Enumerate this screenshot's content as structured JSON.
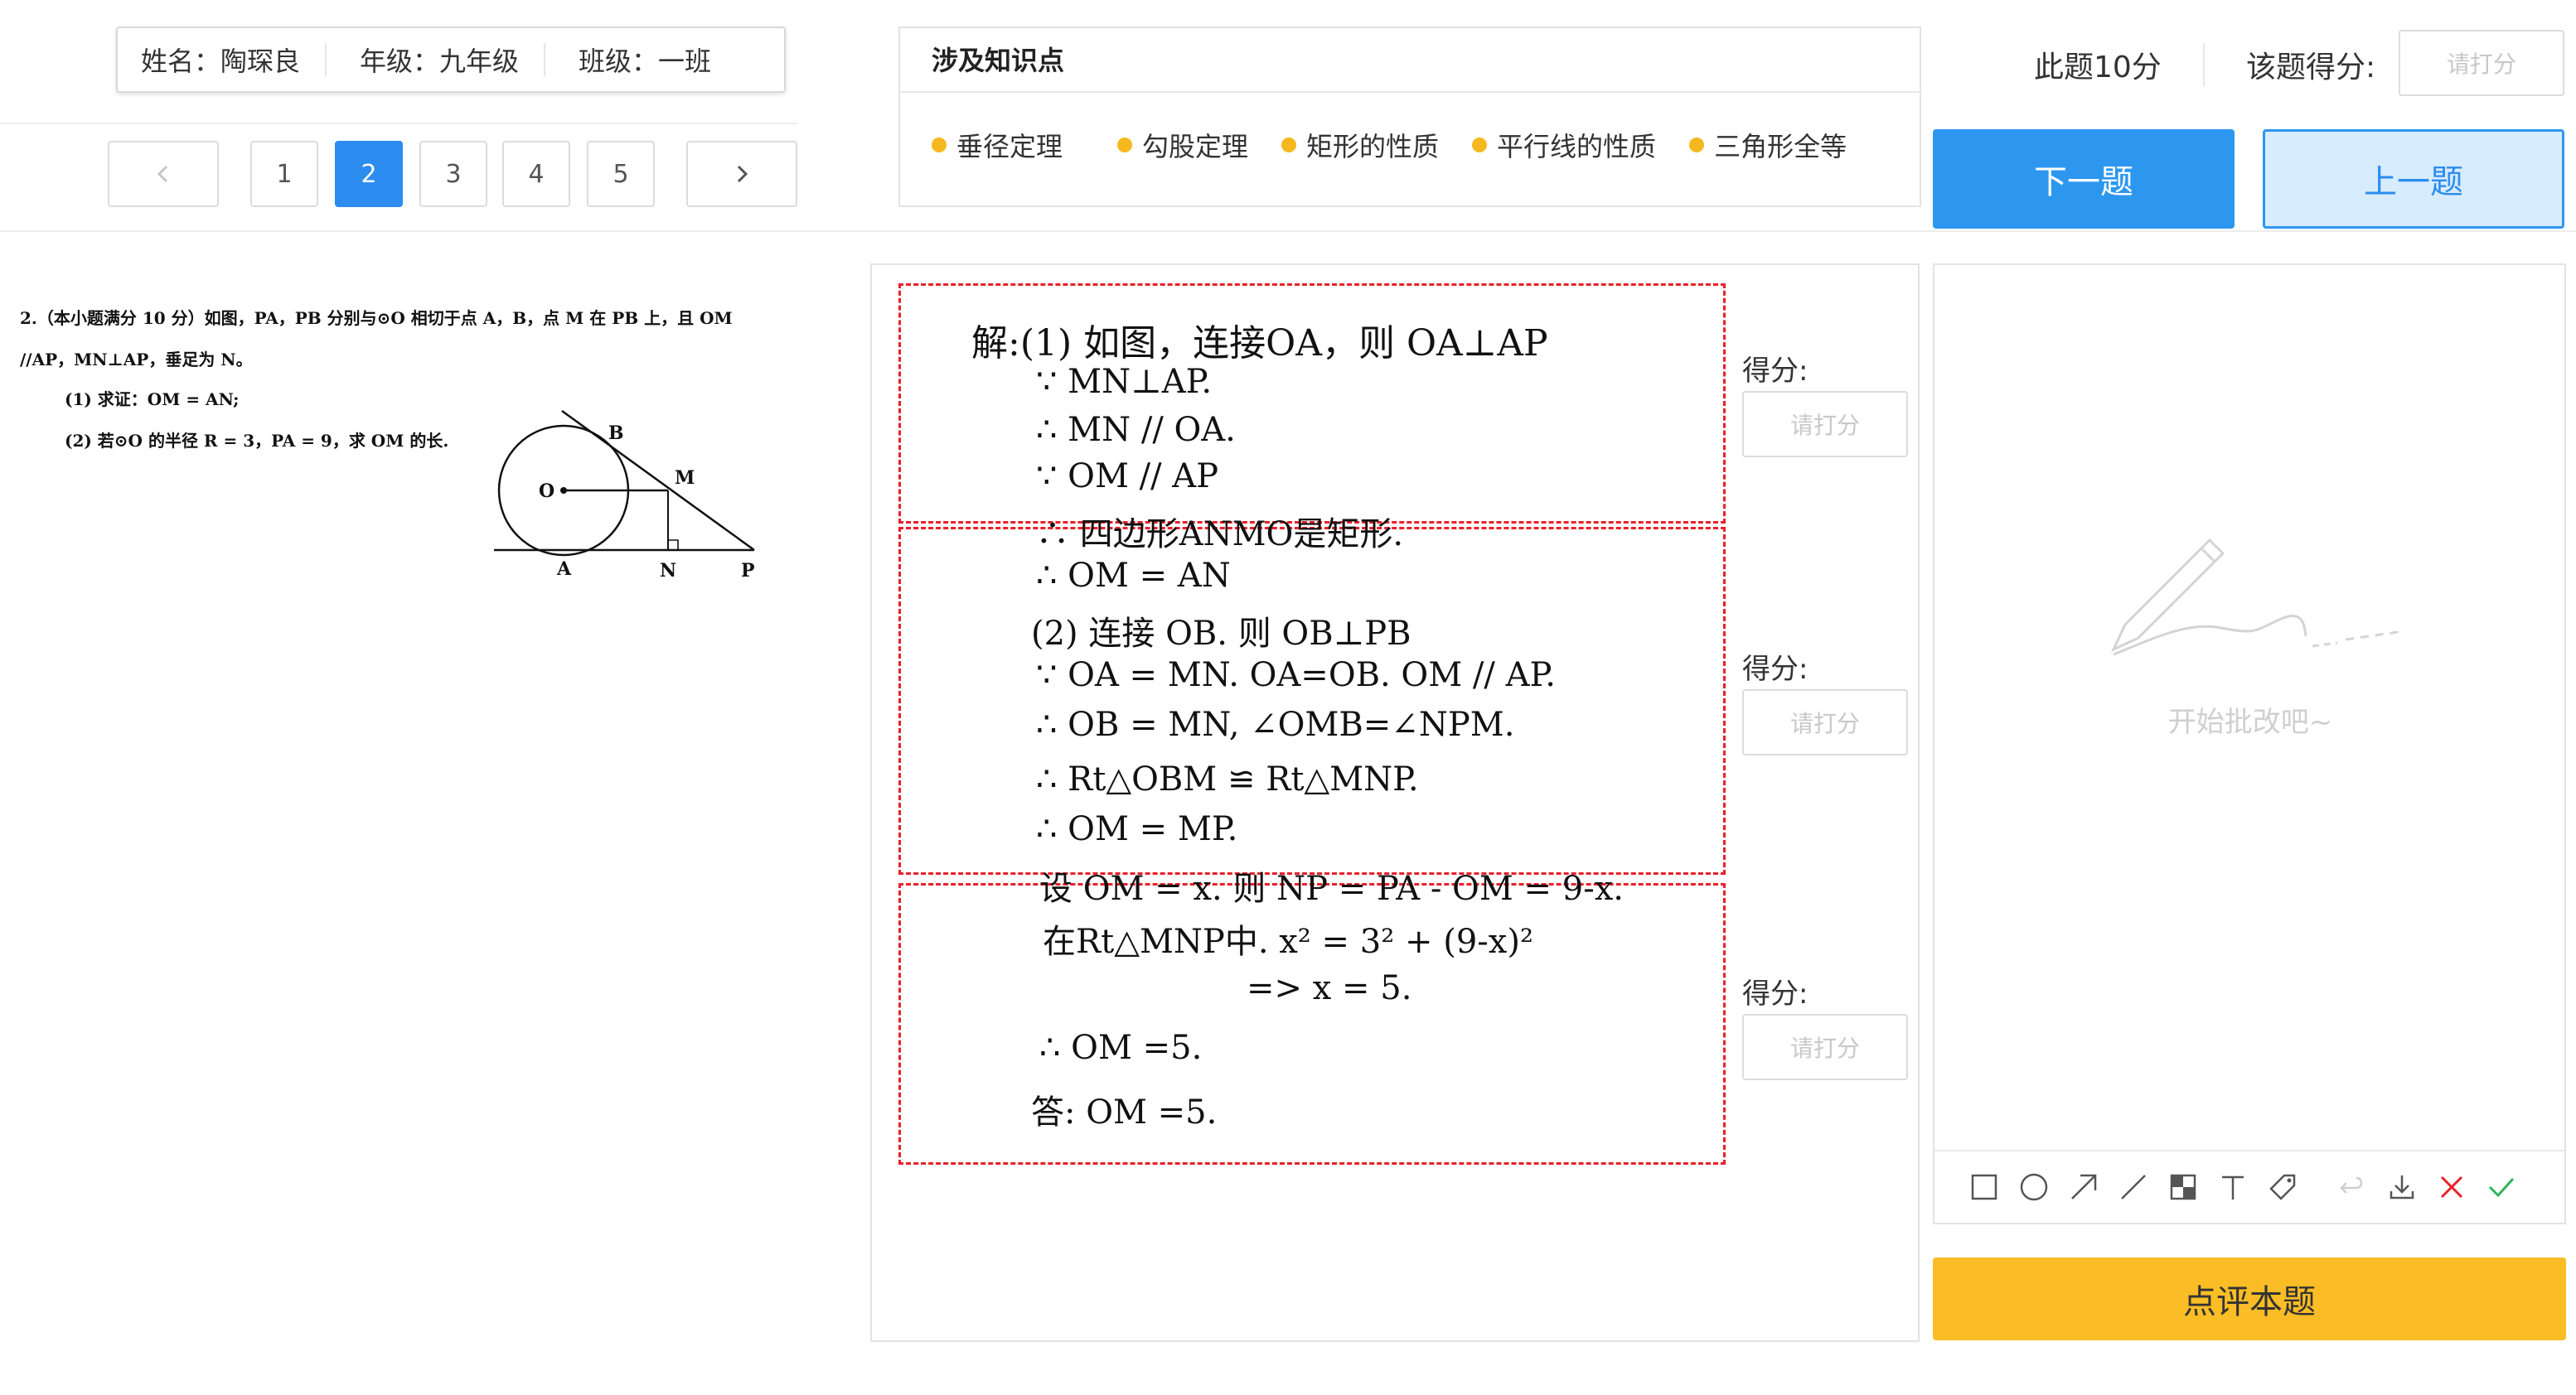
{
  "student": {
    "name_label": "姓名：陶琛良",
    "grade_label": "年级：九年级",
    "class_label": "班级：一班"
  },
  "pager": {
    "pages": [
      "1",
      "2",
      "3",
      "4",
      "5"
    ],
    "current": "2"
  },
  "knowledge": {
    "title": "涉及知识点",
    "items": [
      "垂径定理",
      "勾股定理",
      "矩形的性质",
      "平行线的性质",
      "三角形全等"
    ]
  },
  "score_header": {
    "total": "此题10分",
    "label": "该题得分:",
    "placeholder": "请打分"
  },
  "buttons": {
    "next": "下一题",
    "prev": "上一题",
    "review": "点评本题"
  },
  "question": {
    "line1": "2.（本小题满分 10 分）如图，PA，PB 分别与⊙O 相切于点 A，B，点 M 在 PB 上，且 OM",
    "line2": "//AP，MN⊥AP，垂足为 N。",
    "line3": "(1) 求证：OM = AN;",
    "line4": "(2) 若⊙O 的半径 R = 3，PA = 9，求 OM 的长.",
    "figure_labels": {
      "O": "O",
      "B": "B",
      "M": "M",
      "A": "A",
      "N": "N",
      "P": "P"
    }
  },
  "answer": {
    "lines": [
      "解:(1) 如图，连接OA，则 OA⊥AP",
      "∵ MN⊥AP.",
      "∴ MN // OA.",
      "∵ OM // AP",
      "∴ 四边形ANMO是矩形.",
      "∴ OM = AN",
      "(2) 连接 OB. 则 OB⊥PB",
      "∵ OA = MN. OA=OB. OM // AP.",
      "∴ OB = MN, ∠OMB=∠NPM.",
      "∴ Rt△OBM ≌ Rt△MNP.",
      "∴ OM = MP.",
      "设 OM = x. 则 NP = PA - OM = 9-x.",
      "在Rt△MNP中. x² = 3² + (9-x)²",
      "=> x = 5.",
      "∴ OM =5.",
      "答: OM =5."
    ],
    "section_score_label": "得分:",
    "section_placeholder": "请打分"
  },
  "marking": {
    "empty_text": "开始批改吧~"
  },
  "colors": {
    "primary": "#2d97f0",
    "accent_yellow": "#fbbd25",
    "dashed_red": "#e8202a",
    "dot": "#f5b81f"
  }
}
